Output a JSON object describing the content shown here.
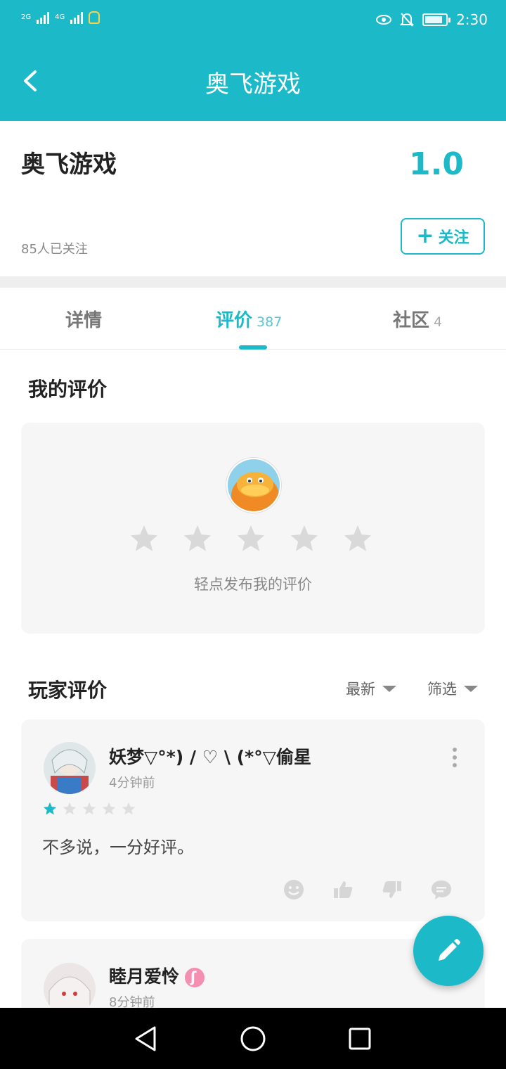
{
  "status_bar": {
    "signal_1": "2G",
    "signal_2": "4G",
    "time": "2:30",
    "icons": [
      "signal-icon",
      "signal-icon",
      "vpn-lock-icon",
      "eye-comfort-icon",
      "bell-off-icon",
      "battery-icon"
    ]
  },
  "header": {
    "title": "奥飞游戏",
    "back_icon": "chevron-left-icon"
  },
  "game": {
    "name": "奥飞游戏",
    "score": "1.0",
    "followers": "85人已关注",
    "follow_label": "关注",
    "follow_icon": "+"
  },
  "tabs": [
    {
      "label": "详情",
      "count": ""
    },
    {
      "label": "评价",
      "count": "387",
      "active": true
    },
    {
      "label": "社区",
      "count": "4"
    }
  ],
  "my_review": {
    "title": "我的评价",
    "hint": "轻点发布我的评价",
    "rating": 0,
    "max_rating": 5
  },
  "player_reviews": {
    "title": "玩家评价",
    "sort_label": "最新",
    "filter_label": "筛选",
    "items": [
      {
        "user": "妖梦▽°*) / ♡ \\ (*°▽偷星",
        "time": "4分钟前",
        "rating": 1,
        "text": "不多说，一分好评。"
      },
      {
        "user": "睦月爱怜",
        "time": "8分钟前",
        "rating": null,
        "text": ""
      }
    ]
  },
  "colors": {
    "accent": "#1cb9c8",
    "star_empty": "#d9d9d9",
    "card_bg": "#f6f6f6"
  }
}
